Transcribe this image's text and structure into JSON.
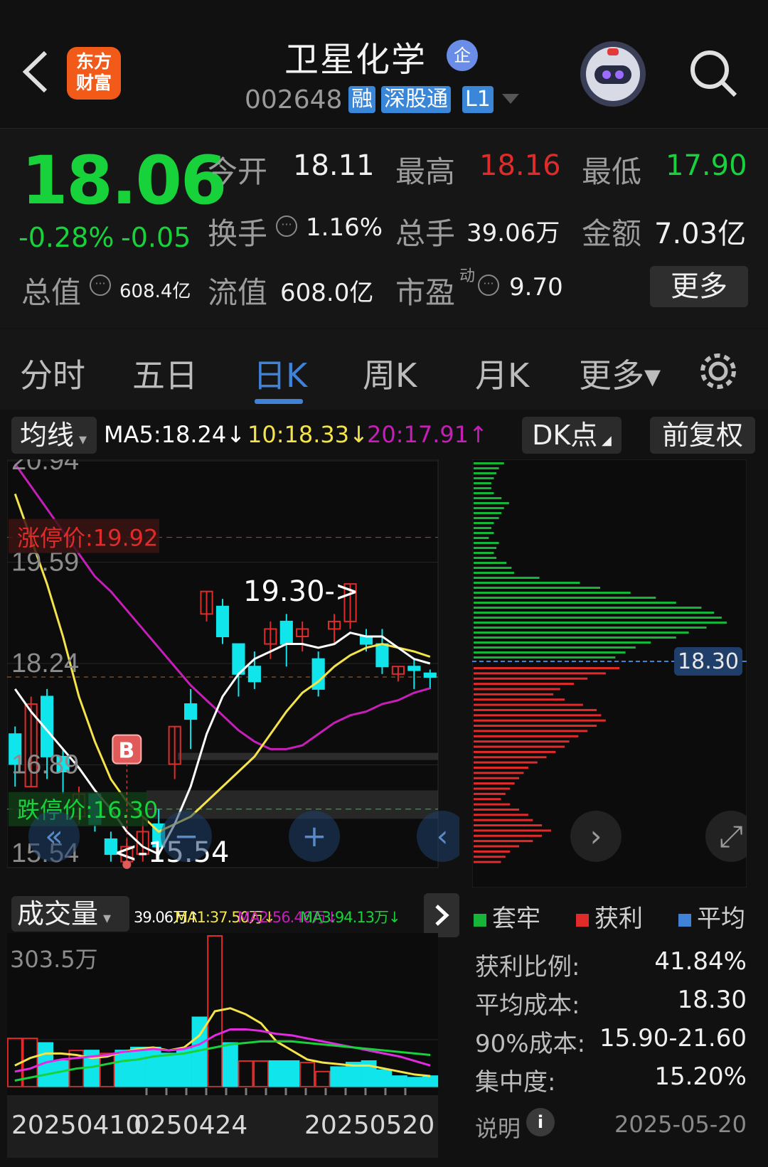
{
  "header": {
    "title": "卫星化学",
    "badge": "企",
    "logo_line1": "东方",
    "logo_line2": "财富",
    "code": "002648",
    "tags": [
      "融",
      "深股通",
      "L1"
    ]
  },
  "quote": {
    "price": "18.06",
    "change_pct": "-0.28%",
    "change_abs": "-0.05",
    "open_label": "今开",
    "open": "18.11",
    "high_label": "最高",
    "high": "18.16",
    "low_label": "最低",
    "low": "17.90",
    "turnover_label": "换手",
    "turnover": "1.16%",
    "volume_label": "总手",
    "volume": "39.06万",
    "amount_label": "金额",
    "amount": "7.03亿",
    "mktcap_label": "总值",
    "mktcap": "608.4亿",
    "float_label": "流值",
    "float_cap": "608.0亿",
    "pe_label": "市盈",
    "pe_sup": "动",
    "pe": "9.70",
    "more_label": "更多"
  },
  "tabs": [
    {
      "label": "分时"
    },
    {
      "label": "五日"
    },
    {
      "label": "日K",
      "active": true
    },
    {
      "label": "周K"
    },
    {
      "label": "月K"
    },
    {
      "label": "更多▾"
    }
  ],
  "toolbar": {
    "indicator": "均线",
    "ma5": "MA5:18.24↓",
    "ma10": "10:18.33↓",
    "ma20": "20:17.91↑",
    "dk": "DK点",
    "adjust": "前复权"
  },
  "colors": {
    "up": "#e02b2b",
    "down": "#11e5ec",
    "ma5": "#ffffff",
    "ma10": "#f4e44a",
    "ma20": "#c51fb8",
    "green": "#17d23a",
    "accent": "#3f82d8"
  },
  "kline": {
    "y_labels": [
      "20.94",
      "19.59",
      "18.24",
      "16.89",
      "15.54"
    ],
    "limit_up": "涨停价:19.92",
    "limit_down": "跌停价:16.30",
    "high_annot": "19.30->",
    "low_annot": "<-15.54",
    "buy_marker": "B",
    "cost_label": "18.30",
    "candles": [
      {
        "o": 17.3,
        "c": 16.9,
        "h": 17.4,
        "l": 16.6
      },
      {
        "o": 16.6,
        "c": 17.7,
        "h": 17.8,
        "l": 16.6
      },
      {
        "o": 17.8,
        "c": 17.0,
        "h": 17.9,
        "l": 16.7
      },
      {
        "o": 17.0,
        "c": 16.8,
        "h": 17.1,
        "l": 16.5
      },
      {
        "o": 16.2,
        "c": 16.5,
        "h": 16.6,
        "l": 16.1
      },
      {
        "o": 16.5,
        "c": 16.1,
        "h": 16.5,
        "l": 16.0
      },
      {
        "o": 15.9,
        "c": 15.7,
        "h": 16.0,
        "l": 15.6
      },
      {
        "o": 15.6,
        "c": 15.8,
        "h": 15.9,
        "l": 15.54
      },
      {
        "o": 15.7,
        "c": 16.0,
        "h": 16.2,
        "l": 15.6
      },
      {
        "o": 16.1,
        "c": 15.8,
        "h": 16.3,
        "l": 15.6
      },
      {
        "o": 16.9,
        "c": 17.4,
        "h": 17.4,
        "l": 16.7
      },
      {
        "o": 17.7,
        "c": 17.5,
        "h": 17.9,
        "l": 17.1
      },
      {
        "o": 18.9,
        "c": 19.2,
        "h": 19.2,
        "l": 18.8
      },
      {
        "o": 19.0,
        "c": 18.6,
        "h": 19.1,
        "l": 18.5
      },
      {
        "o": 18.5,
        "c": 18.1,
        "h": 18.5,
        "l": 17.8
      },
      {
        "o": 18.2,
        "c": 18.0,
        "h": 18.4,
        "l": 17.9
      },
      {
        "o": 18.5,
        "c": 18.7,
        "h": 18.8,
        "l": 18.3
      },
      {
        "o": 18.8,
        "c": 18.5,
        "h": 18.9,
        "l": 18.2
      },
      {
        "o": 18.6,
        "c": 18.7,
        "h": 18.8,
        "l": 18.4
      },
      {
        "o": 18.3,
        "c": 17.9,
        "h": 18.4,
        "l": 17.8
      },
      {
        "o": 18.7,
        "c": 18.8,
        "h": 18.9,
        "l": 18.5
      },
      {
        "o": 18.8,
        "c": 19.3,
        "h": 19.3,
        "l": 18.7
      },
      {
        "o": 18.6,
        "c": 18.5,
        "h": 18.7,
        "l": 18.4
      },
      {
        "o": 18.5,
        "c": 18.2,
        "h": 18.7,
        "l": 18.1
      },
      {
        "o": 18.1,
        "c": 18.2,
        "h": 18.2,
        "l": 18.0
      },
      {
        "o": 18.2,
        "c": 18.15,
        "h": 18.3,
        "l": 17.9
      },
      {
        "o": 18.11,
        "c": 18.06,
        "h": 18.16,
        "l": 17.9
      }
    ],
    "ma5": [
      17.9,
      17.6,
      17.35,
      17.1,
      16.85,
      16.55,
      16.3,
      16.0,
      15.8,
      15.7,
      16.1,
      16.6,
      17.3,
      17.8,
      18.1,
      18.3,
      18.4,
      18.5,
      18.5,
      18.45,
      18.5,
      18.65,
      18.6,
      18.6,
      18.45,
      18.3,
      18.24
    ],
    "ma10": [
      20.5,
      19.9,
      19.3,
      18.6,
      17.8,
      17.2,
      16.7,
      16.4,
      16.2,
      16.0,
      16.1,
      16.2,
      16.4,
      16.6,
      16.8,
      17.0,
      17.3,
      17.6,
      17.85,
      18.0,
      18.2,
      18.35,
      18.45,
      18.5,
      18.45,
      18.4,
      18.33
    ],
    "ma20": [
      20.9,
      20.6,
      20.3,
      20.0,
      19.7,
      19.4,
      19.2,
      18.95,
      18.7,
      18.45,
      18.2,
      17.95,
      17.75,
      17.55,
      17.35,
      17.2,
      17.1,
      17.1,
      17.15,
      17.3,
      17.45,
      17.55,
      17.6,
      17.7,
      17.75,
      17.85,
      17.91
    ]
  },
  "volume": {
    "indicator": "成交量",
    "stats_text": "39.06万↑",
    "ma1": "MA1:37.50万↓",
    "ma2": "MA2:56.46万↓",
    "ma3": "MA3:94.13万↓",
    "y_label": "303.5万",
    "x_labels": [
      "20250410",
      "0250424",
      "20250520"
    ],
    "bars": [
      0.32,
      0.32,
      0.29,
      0.17,
      0.24,
      0.24,
      0.22,
      0.24,
      0.26,
      0.26,
      0.22,
      0.25,
      0.46,
      1.0,
      0.29,
      0.17,
      0.17,
      0.17,
      0.17,
      0.16,
      0.1,
      0.13,
      0.16,
      0.17,
      0.11,
      0.07,
      0.06,
      0.07
    ]
  },
  "distribution": {
    "legend": [
      "套牢",
      "获利",
      "平均"
    ],
    "stats": [
      {
        "label": "获利比例:",
        "value": "41.84%"
      },
      {
        "label": "平均成本:",
        "value": "18.30"
      },
      {
        "label": "90%成本:",
        "value": "15.90-21.60"
      },
      {
        "label": "集中度:",
        "value": "15.20%"
      }
    ],
    "note_label": "说明",
    "date": "2025-05-20"
  }
}
